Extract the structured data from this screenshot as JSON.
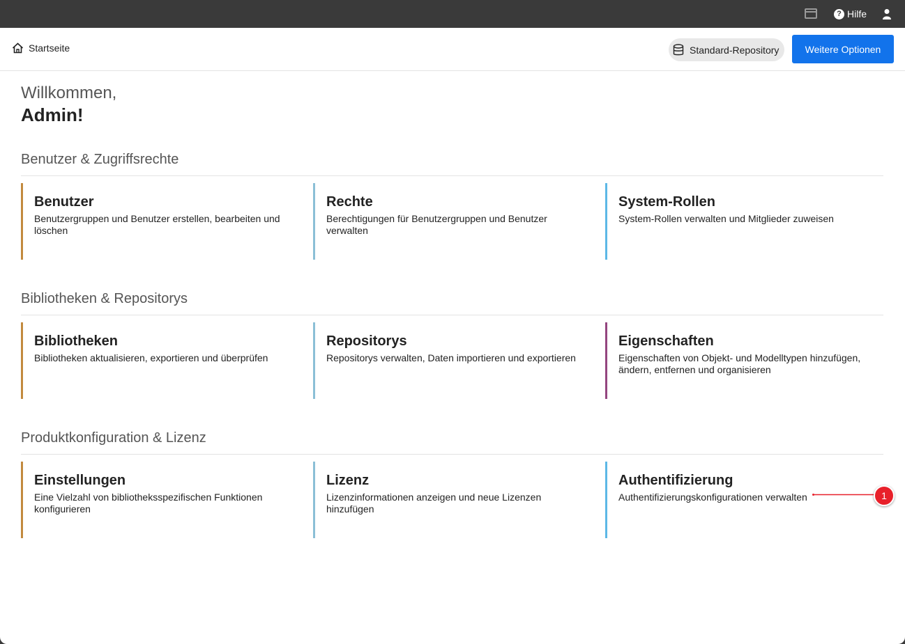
{
  "topbar": {
    "help_label": "Hilfe",
    "icons": [
      "window-icon",
      "help-icon",
      "user-icon"
    ]
  },
  "navbar": {
    "home_label": "Startseite",
    "repository_label": "Standard-Repository",
    "options_label": "Weitere Optionen"
  },
  "welcome": {
    "line1": "Willkommen,",
    "line2": "Admin!"
  },
  "sections": [
    {
      "title": "Benutzer & Zugriffsrechte",
      "cards": [
        {
          "title": "Benutzer",
          "desc": "Benutzergruppen und Benutzer erstellen, bearbeiten und löschen",
          "color": "#c28a3e"
        },
        {
          "title": "Rechte",
          "desc": "Berechtigungen für Benutzergruppen und Benutzer verwalten",
          "color": "#8bbfd6"
        },
        {
          "title": "System-Rollen",
          "desc": "System-Rollen verwalten und Mitglieder zuweisen",
          "color": "#5cb8e6"
        }
      ]
    },
    {
      "title": "Bibliotheken & Repositorys",
      "cards": [
        {
          "title": "Bibliotheken",
          "desc": "Bibliotheken aktualisieren, exportieren und überprüfen",
          "color": "#c28a3e"
        },
        {
          "title": "Repositorys",
          "desc": "Repositorys verwalten, Daten importieren und exportieren",
          "color": "#8bbfd6"
        },
        {
          "title": "Eigenschaften",
          "desc": "Eigenschaften von Objekt- und Modelltypen hinzufügen, ändern, entfernen und organisieren",
          "color": "#94457f"
        }
      ]
    },
    {
      "title": "Produktkonfiguration & Lizenz",
      "cards": [
        {
          "title": "Einstellungen",
          "desc": "Eine Vielzahl von bibliotheksspezifischen Funktionen konfigurieren",
          "color": "#c28a3e"
        },
        {
          "title": "Lizenz",
          "desc": "Lizenzinformationen anzeigen und neue Lizenzen hinzufügen",
          "color": "#8bbfd6"
        },
        {
          "title": "Authentifizierung",
          "desc": "Authentifizierungskonfigurationen verwalten",
          "color": "#5cb8e6"
        }
      ]
    }
  ],
  "annotation": {
    "label": "1",
    "color": "#e8202a"
  }
}
